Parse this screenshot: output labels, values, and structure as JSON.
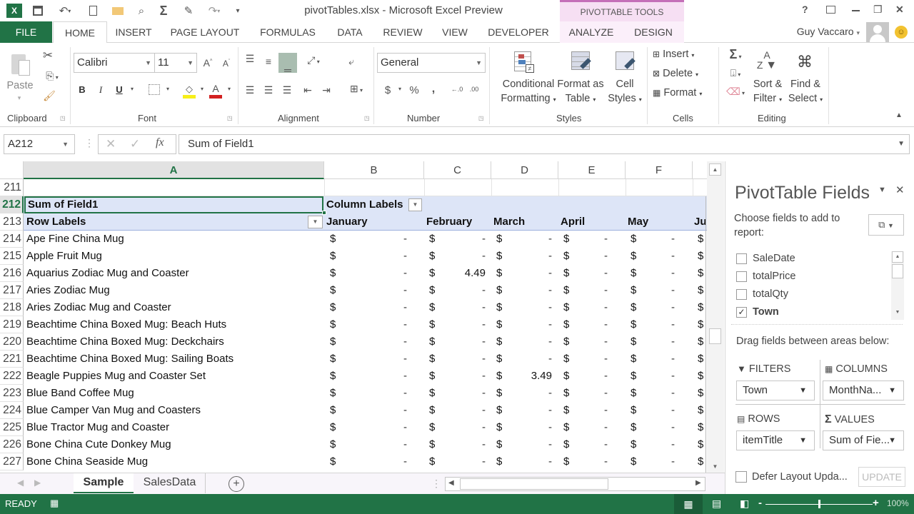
{
  "window": {
    "title": "pivotTables.xlsx - Microsoft Excel Preview",
    "contextual_group": "PIVOTTABLE TOOLS",
    "user_name": "Guy Vaccaro",
    "controls": {
      "help": "?",
      "fullscreen": "⧠",
      "minimize": "—",
      "restore": "❐",
      "close": "✕"
    }
  },
  "quick_access": [
    {
      "name": "excel-logo-icon",
      "glyph": "X"
    },
    {
      "name": "save-icon",
      "glyph": "💾"
    },
    {
      "name": "undo-icon",
      "glyph": "↶"
    },
    {
      "name": "new-document-icon",
      "glyph": "🗋"
    },
    {
      "name": "open-folder-icon",
      "glyph": "📂"
    },
    {
      "name": "print-preview-icon",
      "glyph": "🔍"
    },
    {
      "name": "autosum-icon",
      "glyph": "Σ"
    },
    {
      "name": "spelling-icon",
      "glyph": "✎"
    },
    {
      "name": "redo-icon",
      "glyph": "↷"
    },
    {
      "name": "customize-icon",
      "glyph": "⩡"
    }
  ],
  "tabs": [
    "FILE",
    "HOME",
    "INSERT",
    "PAGE LAYOUT",
    "FORMULAS",
    "DATA",
    "REVIEW",
    "VIEW",
    "DEVELOPER",
    "ANALYZE",
    "DESIGN"
  ],
  "active_tab": "HOME",
  "ribbon": {
    "clipboard": {
      "label": "Clipboard",
      "paste": "Paste"
    },
    "font": {
      "label": "Font",
      "font_name": "Calibri",
      "font_size": "11",
      "bold": "B",
      "italic": "I",
      "underline": "U",
      "highlight_color": "#f7ef1a",
      "font_color": "#d22020"
    },
    "alignment": {
      "label": "Alignment"
    },
    "number": {
      "label": "Number",
      "format": "General",
      "currency": "$",
      "percent": "%",
      "comma": ","
    },
    "styles": {
      "label": "Styles",
      "conditional_formatting": [
        "Conditional",
        "Formatting"
      ],
      "format_as_table": [
        "Format as",
        "Table"
      ],
      "cell_styles": [
        "Cell",
        "Styles"
      ]
    },
    "cells": {
      "label": "Cells",
      "insert": "Insert",
      "delete": "Delete",
      "format": "Format"
    },
    "editing": {
      "label": "Editing",
      "sort_filter": [
        "Sort &",
        "Filter"
      ],
      "find_select": [
        "Find &",
        "Select"
      ]
    }
  },
  "formula_bar": {
    "name_box": "A212",
    "formula": "Sum of Field1",
    "fx": "fx"
  },
  "columns": [
    "A",
    "B",
    "C",
    "D",
    "E",
    "F"
  ],
  "pivot": {
    "first_row_number": "211",
    "values_caption": {
      "row": "212",
      "text": "Sum of Field1"
    },
    "column_labels": "Column Labels",
    "header_row": {
      "row": "213",
      "row_labels": "Row Labels",
      "months": [
        "January",
        "February",
        "March",
        "April",
        "May",
        "Ju"
      ]
    },
    "rows": [
      {
        "row": "214",
        "label": "Ape Fine China Mug",
        "values": [
          "-",
          "-",
          "-",
          "-",
          "-"
        ]
      },
      {
        "row": "215",
        "label": "Apple Fruit Mug",
        "values": [
          "-",
          "-",
          "-",
          "-",
          "-"
        ]
      },
      {
        "row": "216",
        "label": "Aquarius Zodiac Mug and Coaster",
        "values": [
          "-",
          "4.49",
          "-",
          "-",
          "-"
        ]
      },
      {
        "row": "217",
        "label": "Aries Zodiac Mug",
        "values": [
          "-",
          "-",
          "-",
          "-",
          "-"
        ]
      },
      {
        "row": "218",
        "label": "Aries Zodiac Mug and Coaster",
        "values": [
          "-",
          "-",
          "-",
          "-",
          "-"
        ]
      },
      {
        "row": "219",
        "label": "Beachtime China Boxed Mug: Beach Huts",
        "values": [
          "-",
          "-",
          "-",
          "-",
          "-"
        ]
      },
      {
        "row": "220",
        "label": "Beachtime China Boxed Mug: Deckchairs",
        "values": [
          "-",
          "-",
          "-",
          "-",
          "-"
        ]
      },
      {
        "row": "221",
        "label": "Beachtime China Boxed Mug: Sailing Boats",
        "values": [
          "-",
          "-",
          "-",
          "-",
          "-"
        ]
      },
      {
        "row": "222",
        "label": "Beagle Puppies Mug and Coaster Set",
        "values": [
          "-",
          "-",
          "3.49",
          "-",
          "-"
        ]
      },
      {
        "row": "223",
        "label": "Blue Band Coffee Mug",
        "values": [
          "-",
          "-",
          "-",
          "-",
          "-"
        ]
      },
      {
        "row": "224",
        "label": "Blue Camper Van Mug and Coasters",
        "values": [
          "-",
          "-",
          "-",
          "-",
          "-"
        ]
      },
      {
        "row": "225",
        "label": "Blue Tractor Mug and Coaster",
        "values": [
          "-",
          "-",
          "-",
          "-",
          "-"
        ]
      },
      {
        "row": "226",
        "label": "Bone China Cute Donkey Mug",
        "values": [
          "-",
          "-",
          "-",
          "-",
          "-"
        ]
      },
      {
        "row": "227",
        "label": "Bone China Seaside Mug",
        "values": [
          "-",
          "-",
          "-",
          "-",
          "-"
        ]
      }
    ],
    "currency_symbol": "$"
  },
  "sheets": {
    "tabs": [
      "Sample",
      "SalesData"
    ],
    "active": "Sample",
    "add_glyph": "+"
  },
  "status": {
    "text": "READY",
    "zoom": "100%"
  },
  "pivot_pane": {
    "title": "PivotTable Fields",
    "choose_label": "Choose fields to add to report:",
    "fields": [
      {
        "name": "SaleDate",
        "checked": false
      },
      {
        "name": "totalPrice",
        "checked": false
      },
      {
        "name": "totalQty",
        "checked": false
      },
      {
        "name": "Town",
        "checked": true
      }
    ],
    "drag_label": "Drag fields between areas below:",
    "areas": {
      "filters": {
        "label": "FILTERS",
        "value": "Town"
      },
      "columns": {
        "label": "COLUMNS",
        "value": "MonthNa..."
      },
      "rows": {
        "label": "ROWS",
        "value": "itemTitle"
      },
      "values": {
        "label": "VALUES",
        "value": "Sum of Fie..."
      }
    },
    "defer_label": "Defer Layout Upda...",
    "update_button": "UPDATE"
  }
}
